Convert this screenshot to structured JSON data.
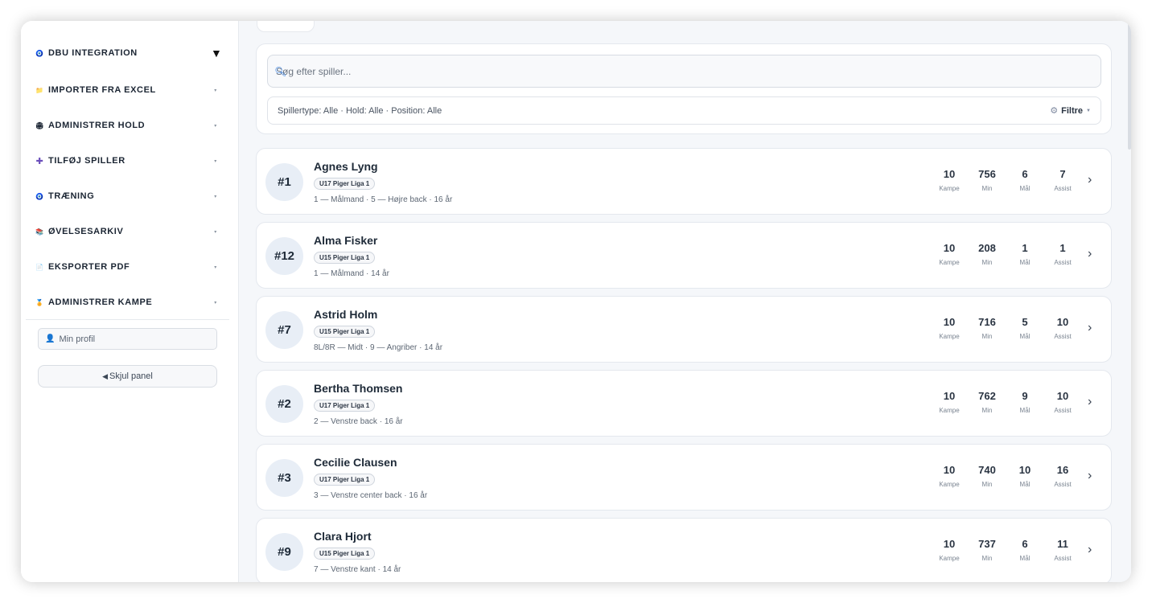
{
  "sidebar": {
    "items": [
      {
        "icon": "🧿",
        "icon_name": "globe-icon",
        "label": "DBU INTEGRATION",
        "caret": "▼"
      },
      {
        "icon": "📁",
        "icon_name": "folder-icon",
        "label": "IMPORTER FRA EXCEL",
        "caret": "▾"
      },
      {
        "icon": "🏟",
        "icon_name": "stadium-icon",
        "label": "ADMINISTRER HOLD",
        "caret": "▾"
      },
      {
        "icon": "➕",
        "icon_name": "plus-icon",
        "label": "TILFØJ SPILLER",
        "caret": "▾"
      },
      {
        "icon": "🧿",
        "icon_name": "globe-icon",
        "label": "TRÆNING",
        "caret": "▾"
      },
      {
        "icon": "📚",
        "icon_name": "books-icon",
        "label": "ØVELSESARKIV",
        "caret": "▾"
      },
      {
        "icon": "📄",
        "icon_name": "document-icon",
        "label": "EKSPORTER PDF",
        "caret": "▾"
      },
      {
        "icon": "🏅",
        "icon_name": "medal-icon",
        "label": "ADMINISTRER KAMPE",
        "caret": "▾"
      }
    ],
    "profile": {
      "icon": "👤",
      "label": "Min profil"
    },
    "hide_panel": {
      "icon": "◀",
      "label": "Skjul panel"
    }
  },
  "search": {
    "placeholder": "Søg efter spiller...",
    "filter_summary": "Spillertype: Alle · Hold: Alle · Position: Alle",
    "filter_button": "Filtre"
  },
  "stat_labels": {
    "games": "Kampe",
    "minutes": "Min",
    "goals": "Mål",
    "assists": "Assist"
  },
  "players": [
    {
      "number": "#1",
      "name": "Agnes Lyng",
      "team": "U17 Piger Liga 1",
      "meta": "1 — Målmand · 5 — Højre back · 16 år",
      "games": "10",
      "minutes": "756",
      "goals": "6",
      "assists": "7"
    },
    {
      "number": "#12",
      "name": "Alma Fisker",
      "team": "U15 Piger Liga 1",
      "meta": "1 — Målmand · 14 år",
      "games": "10",
      "minutes": "208",
      "goals": "1",
      "assists": "1"
    },
    {
      "number": "#7",
      "name": "Astrid Holm",
      "team": "U15 Piger Liga 1",
      "meta": "8L/8R — Midt · 9 — Angriber · 14 år",
      "games": "10",
      "minutes": "716",
      "goals": "5",
      "assists": "10"
    },
    {
      "number": "#2",
      "name": "Bertha Thomsen",
      "team": "U17 Piger Liga 1",
      "meta": "2 — Venstre back · 16 år",
      "games": "10",
      "minutes": "762",
      "goals": "9",
      "assists": "10"
    },
    {
      "number": "#3",
      "name": "Cecilie Clausen",
      "team": "U17 Piger Liga 1",
      "meta": "3 — Venstre center back · 16 år",
      "games": "10",
      "minutes": "740",
      "goals": "10",
      "assists": "16"
    },
    {
      "number": "#9",
      "name": "Clara Hjort",
      "team": "U15 Piger Liga 1",
      "meta": "7 — Venstre kant · 14 år",
      "games": "10",
      "minutes": "737",
      "goals": "6",
      "assists": "11"
    }
  ]
}
